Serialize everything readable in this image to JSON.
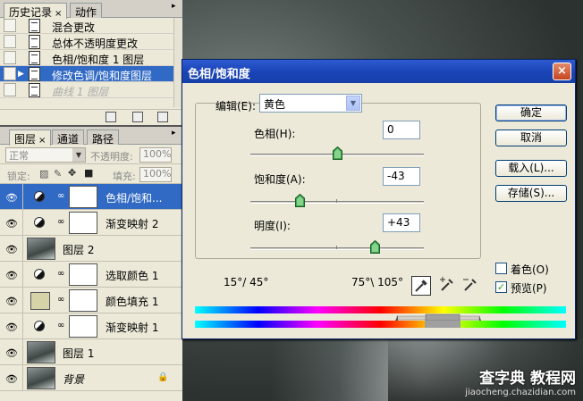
{
  "history_panel": {
    "tabs": [
      "历史记录",
      "动作"
    ],
    "close_glyph": "×",
    "items": [
      {
        "label": "混合更改",
        "state": "normal"
      },
      {
        "label": "总体不透明度更改",
        "state": "normal"
      },
      {
        "label": "色相/饱和度 1 图层",
        "state": "normal"
      },
      {
        "label": "修改色调/饱和度图层",
        "state": "selected"
      },
      {
        "label": "曲线 1 图层",
        "state": "disabled"
      }
    ]
  },
  "layers_panel": {
    "tabs": [
      "图层",
      "通道",
      "路径"
    ],
    "close_glyph": "×",
    "blend_mode": "正常",
    "opacity_label": "不透明度:",
    "opacity_value": "100%",
    "lock_label": "锁定:",
    "fill_label": "填充:",
    "fill_value": "100%",
    "layers": [
      {
        "name": "色相/饱和...",
        "kind": "adjustment",
        "selected": true
      },
      {
        "name": "渐变映射 2",
        "kind": "adjustment",
        "selected": false
      },
      {
        "name": "图层 2",
        "kind": "image",
        "selected": false
      },
      {
        "name": "选取颜色 1",
        "kind": "adjustment",
        "selected": false
      },
      {
        "name": "颜色填充 1",
        "kind": "fill",
        "fill_color": "#d6d3a8",
        "selected": false
      },
      {
        "name": "渐变映射 1",
        "kind": "adjustment",
        "selected": false
      },
      {
        "name": "图层 1",
        "kind": "image",
        "selected": false
      },
      {
        "name": "背景",
        "kind": "background",
        "selected": false,
        "locked": true
      }
    ]
  },
  "dialog": {
    "title": "色相/饱和度",
    "close_glyph": "×",
    "edit_label": "编辑(E):",
    "edit_value": "黄色",
    "hue_label": "色相(H):",
    "hue_value": "0",
    "saturation_label": "饱和度(A):",
    "saturation_value": "-43",
    "lightness_label": "明度(I):",
    "lightness_value": "+43",
    "sliders": {
      "hue": 0,
      "saturation": -43,
      "lightness": 43
    },
    "range_left": "15°/ 45°",
    "range_right": "75°\\ 105°",
    "buttons": {
      "ok": "确定",
      "cancel": "取消",
      "load": "载入(L)...",
      "save": "存储(S)..."
    },
    "colorize_label": "着色(O)",
    "colorize_checked": false,
    "preview_label": "预览(P)",
    "preview_checked": true,
    "check_glyph": "✓"
  },
  "watermark": {
    "line1": "查字典 教程网",
    "line2": "jiaocheng.chazidian.com"
  }
}
